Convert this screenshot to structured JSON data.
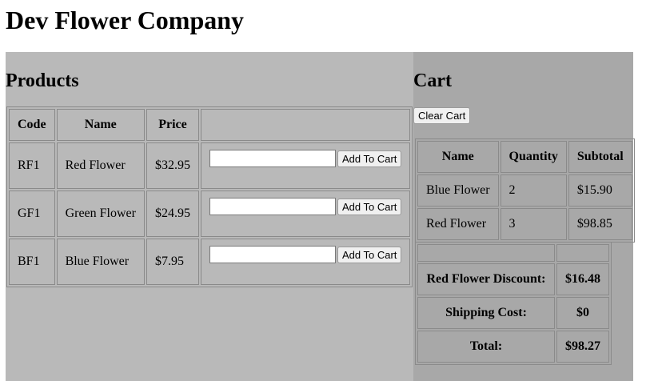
{
  "page": {
    "title": "Dev Flower Company"
  },
  "products": {
    "heading": "Products",
    "columns": {
      "code": "Code",
      "name": "Name",
      "price": "Price"
    },
    "rows": [
      {
        "code": "RF1",
        "name": "Red Flower",
        "price": "$32.95",
        "quantity": "",
        "add_label": "Add To Cart"
      },
      {
        "code": "GF1",
        "name": "Green Flower",
        "price": "$24.95",
        "quantity": "",
        "add_label": "Add To Cart"
      },
      {
        "code": "BF1",
        "name": "Blue Flower",
        "price": "$7.95",
        "quantity": "",
        "add_label": "Add To Cart"
      }
    ]
  },
  "cart": {
    "heading": "Cart",
    "clear_label": "Clear Cart",
    "columns": {
      "name": "Name",
      "quantity": "Quantity",
      "subtotal": "Subtotal"
    },
    "items": [
      {
        "name": "Blue Flower",
        "quantity": "2",
        "subtotal": "$15.90"
      },
      {
        "name": "Red Flower",
        "quantity": "3",
        "subtotal": "$98.85"
      }
    ],
    "summary": {
      "discount_label": "Red Flower Discount:",
      "discount_value": "$16.48",
      "shipping_label": "Shipping Cost:",
      "shipping_value": "$0",
      "total_label": "Total:",
      "total_value": "$98.27"
    }
  }
}
